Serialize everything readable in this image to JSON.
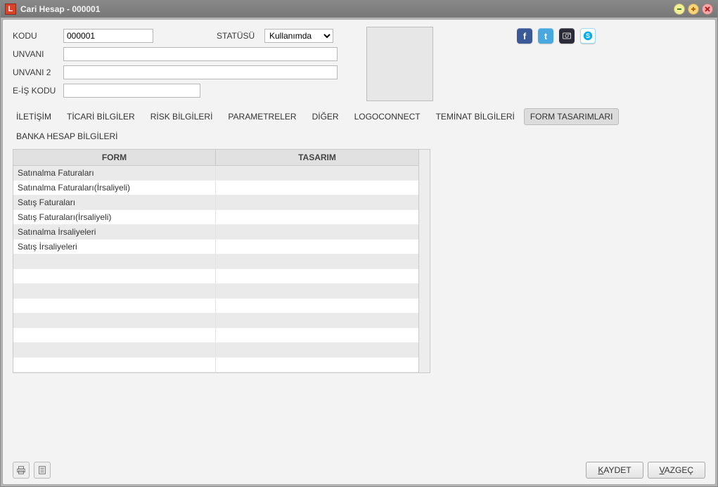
{
  "window": {
    "title": "Cari Hesap - 000001"
  },
  "form": {
    "kodu_label": "KODU",
    "kodu_value": "000001",
    "status_label": "STATÜSÜ",
    "status_value": "Kullanımda",
    "unvani_label": "UNVANI",
    "unvani_value": "",
    "unvani2_label": "UNVANI 2",
    "unvani2_value": "",
    "eis_label": "E-İŞ KODU",
    "eis_value": ""
  },
  "tabs": [
    "İLETİŞİM",
    "TİCARİ BİLGİLER",
    "RİSK BİLGİLERİ",
    "PARAMETRELER",
    "DİĞER",
    "LOGOCONNECT",
    "TEMİNAT BİLGİLERİ",
    "FORM TASARIMLARI",
    "BANKA HESAP BİLGİLERİ"
  ],
  "active_tab": 7,
  "grid": {
    "headers": [
      "FORM",
      "TASARIM"
    ],
    "rows": [
      {
        "form": "Satınalma Faturaları",
        "tasarim": ""
      },
      {
        "form": "Satınalma Faturaları(İrsaliyeli)",
        "tasarim": ""
      },
      {
        "form": "Satış Faturaları",
        "tasarim": ""
      },
      {
        "form": "Satış Faturaları(İrsaliyeli)",
        "tasarim": ""
      },
      {
        "form": "Satınalma İrsaliyeleri",
        "tasarim": ""
      },
      {
        "form": "Satış İrsaliyeleri",
        "tasarim": ""
      },
      {
        "form": "",
        "tasarim": ""
      },
      {
        "form": "",
        "tasarim": ""
      },
      {
        "form": "",
        "tasarim": ""
      },
      {
        "form": "",
        "tasarim": ""
      },
      {
        "form": "",
        "tasarim": ""
      },
      {
        "form": "",
        "tasarim": ""
      },
      {
        "form": "",
        "tasarim": ""
      },
      {
        "form": "",
        "tasarim": ""
      }
    ]
  },
  "footer": {
    "save_label": "KAYDET",
    "save_ul": "K",
    "save_rest": "AYDET",
    "cancel_label": "VAZGEÇ",
    "cancel_ul": "V",
    "cancel_rest": "AZGEÇ"
  },
  "social": {
    "fb": "f",
    "tw": "t"
  }
}
